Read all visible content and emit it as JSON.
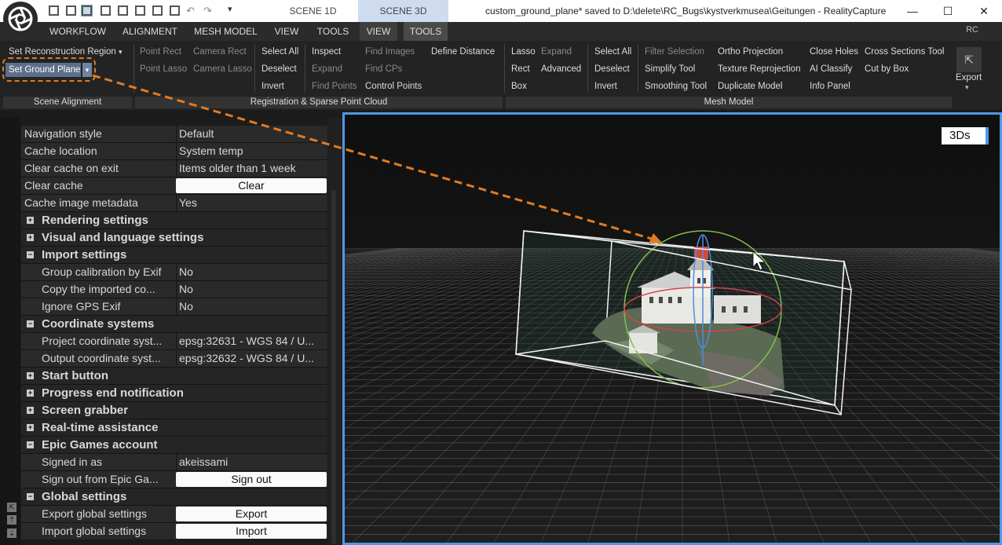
{
  "titlebar": {
    "scene_tabs": [
      "SCENE 1D",
      "SCENE 3D"
    ],
    "window_title": "custom_ground_plane* saved to D:\\delete\\RC_Bugs\\kystverkmusea\\Geitungen - RealityCapture",
    "minimize": "—",
    "maximize": "☐",
    "close": "✕",
    "dropdown": "▾",
    "undo": "↶",
    "redo": "↷"
  },
  "menu": {
    "items": [
      "WORKFLOW",
      "ALIGNMENT",
      "MESH MODEL",
      "VIEW",
      "TOOLS",
      "VIEW",
      "TOOLS"
    ],
    "rc": "RC"
  },
  "ribbon": {
    "set_reconstruction_region": "Set Reconstruction Region",
    "caret": "▾",
    "set_ground_plane": "Set Ground Plane",
    "sgp_arrow": "▾",
    "point_rect": "Point Rect",
    "point_lasso": "Point Lasso",
    "camera_rect": "Camera Rect",
    "camera_lasso": "Camera Lasso",
    "select_all": "Select All",
    "deselect": "Deselect",
    "invert": "Invert",
    "inspect": "Inspect",
    "expand": "Expand",
    "find_points": "Find Points",
    "find_images": "Find Images",
    "find_cps": "Find CPs",
    "control_points": "Control Points",
    "define_distance": "Define Distance",
    "lasso": "Lasso",
    "rect": "Rect",
    "box": "Box",
    "mesh_expand": "Expand",
    "advanced": "Advanced",
    "mesh_select_all": "Select All",
    "mesh_deselect": "Deselect",
    "mesh_invert": "Invert",
    "filter_selection": "Filter Selection",
    "simplify_tool": "Simplify Tool",
    "smoothing_tool": "Smoothing Tool",
    "ortho_projection": "Ortho Projection",
    "texture_reprojection": "Texture Reprojection",
    "duplicate_model": "Duplicate Model",
    "close_holes": "Close Holes",
    "ai_classify": "AI Classify",
    "info_panel": "Info Panel",
    "cross_sections_tool": "Cross Sections Tool",
    "cut_by_box": "Cut by Box",
    "export": "Export",
    "export_icon": "⇱",
    "export_caret": "▾",
    "groups": [
      "Scene Alignment",
      "Registration & Sparse Point Cloud",
      "Mesh Model"
    ]
  },
  "left_strip": [
    "⇱",
    "⇡",
    "⇣"
  ],
  "settings": {
    "expand_plus": "+",
    "expand_minus": "−",
    "rows": [
      {
        "type": "kv",
        "key": "Navigation style",
        "value": "Default"
      },
      {
        "type": "kv",
        "key": "Cache location",
        "value": "System temp"
      },
      {
        "type": "kv",
        "key": "Clear cache on exit",
        "value": "Items older than 1 week"
      },
      {
        "type": "btn",
        "key": "Clear cache",
        "value": "Clear"
      },
      {
        "type": "kv",
        "key": "Cache image metadata",
        "value": "Yes"
      },
      {
        "type": "sec",
        "key": "Rendering settings",
        "expanded": false
      },
      {
        "type": "sec",
        "key": "Visual and language settings",
        "expanded": false
      },
      {
        "type": "sec",
        "key": "Import settings",
        "expanded": true
      },
      {
        "type": "kvi",
        "key": "Group calibration by Exif",
        "value": "No"
      },
      {
        "type": "kvi",
        "key": "Copy the imported co...",
        "value": "No"
      },
      {
        "type": "kvi",
        "key": "Ignore GPS Exif",
        "value": "No"
      },
      {
        "type": "sec",
        "key": "Coordinate systems",
        "expanded": true
      },
      {
        "type": "kvi",
        "key": "Project coordinate syst...",
        "value": "epsg:32631 - WGS 84 / U..."
      },
      {
        "type": "kvi",
        "key": "Output coordinate syst...",
        "value": "epsg:32632 - WGS 84 / U..."
      },
      {
        "type": "sec",
        "key": "Start button",
        "expanded": false
      },
      {
        "type": "sec",
        "key": "Progress end notification",
        "expanded": false
      },
      {
        "type": "sec",
        "key": "Screen grabber",
        "expanded": false
      },
      {
        "type": "sec",
        "key": "Real-time assistance",
        "expanded": false
      },
      {
        "type": "sec",
        "key": "Epic Games account",
        "expanded": true
      },
      {
        "type": "kvi",
        "key": "Signed in as",
        "value": "akeissami"
      },
      {
        "type": "btni",
        "key": "Sign out from Epic Ga...",
        "value": "Sign out"
      },
      {
        "type": "sec",
        "key": "Global settings",
        "expanded": true
      },
      {
        "type": "btni",
        "key": "Export global settings",
        "value": "Export"
      },
      {
        "type": "btni",
        "key": "Import global settings",
        "value": "Import"
      }
    ]
  },
  "viewport": {
    "view_mode": "3Ds",
    "highlight_color": "#4e97e8",
    "annotation_color": "#e27a24"
  }
}
